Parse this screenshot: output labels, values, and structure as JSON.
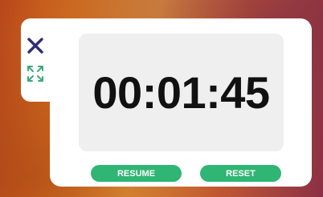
{
  "timer": {
    "display": "00:01:45"
  },
  "controls": {
    "resume_label": "RESUME",
    "reset_label": "RESET"
  },
  "icons": {
    "close": "close-icon",
    "expand": "expand-icon"
  },
  "colors": {
    "accent": "#2fb574",
    "icon": "#2d2d7a",
    "display_bg": "#efefef"
  }
}
